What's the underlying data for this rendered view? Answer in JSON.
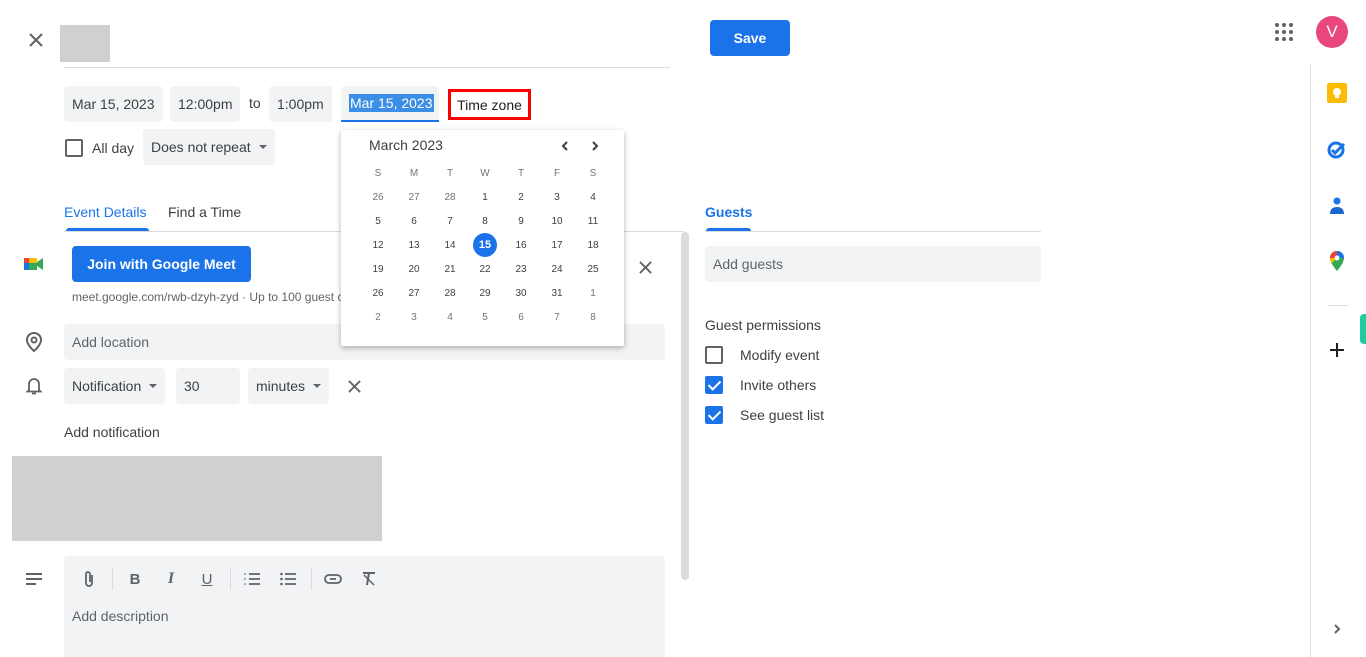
{
  "header": {
    "close_label": "close",
    "save_label": "Save",
    "avatar_initial": "V",
    "apps_icon": "apps-grid-icon"
  },
  "datetime": {
    "start_date": "Mar 15, 2023",
    "start_time": "12:00pm",
    "to_label": "to",
    "end_time": "1:00pm",
    "end_date": "Mar 15, 2023",
    "time_zone_label": "Time zone",
    "all_day_label": "All day",
    "all_day_checked": false,
    "repeat_value": "Does not repeat"
  },
  "calendar": {
    "month_label": "March 2023",
    "weekdays": [
      "S",
      "M",
      "T",
      "W",
      "T",
      "F",
      "S"
    ],
    "weeks": [
      [
        "26",
        "27",
        "28",
        "1",
        "2",
        "3",
        "4"
      ],
      [
        "5",
        "6",
        "7",
        "8",
        "9",
        "10",
        "11"
      ],
      [
        "12",
        "13",
        "14",
        "15",
        "16",
        "17",
        "18"
      ],
      [
        "19",
        "20",
        "21",
        "22",
        "23",
        "24",
        "25"
      ],
      [
        "26",
        "27",
        "28",
        "29",
        "30",
        "31",
        "1"
      ],
      [
        "2",
        "3",
        "4",
        "5",
        "6",
        "7",
        "8"
      ]
    ],
    "selected_day": "15",
    "accent_color": "#1a73e8"
  },
  "tabs": {
    "event_details": "Event Details",
    "find_a_time": "Find a Time",
    "guests": "Guests"
  },
  "meet": {
    "join_label": "Join with Google Meet",
    "link_text": "meet.google.com/rwb-dzyh-zyd · Up to 100 guest c"
  },
  "location": {
    "placeholder": "Add location"
  },
  "notification": {
    "type": "Notification",
    "value": "30",
    "unit": "minutes",
    "add_label": "Add notification"
  },
  "description": {
    "placeholder": "Add description",
    "toolbar": [
      "attach-icon",
      "bold-icon",
      "italic-icon",
      "underline-icon",
      "numbered-list-icon",
      "bulleted-list-icon",
      "link-icon",
      "clear-formatting-icon"
    ]
  },
  "guests": {
    "placeholder": "Add guests",
    "permissions_title": "Guest permissions",
    "permissions": [
      {
        "label": "Modify event",
        "checked": false
      },
      {
        "label": "Invite others",
        "checked": true
      },
      {
        "label": "See guest list",
        "checked": true
      }
    ]
  },
  "side_rail": [
    "keep-icon",
    "tasks-icon",
    "contacts-icon",
    "maps-icon",
    "add-icon"
  ],
  "colors": {
    "primary": "#1a73e8",
    "avatar": "#e8467c",
    "highlight_border": "#ff0000"
  }
}
